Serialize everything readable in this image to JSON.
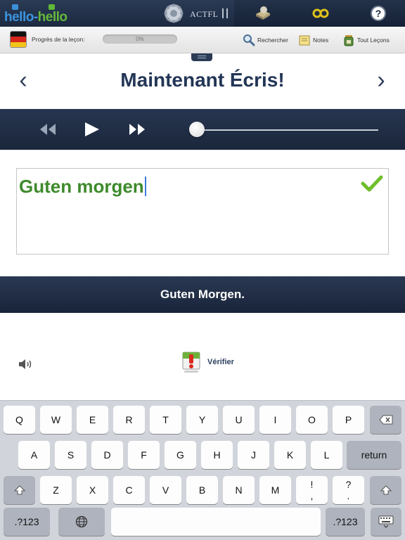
{
  "app": {
    "logo": {
      "part1": "hello-",
      "part2": "hello"
    },
    "badge": "ACTFL",
    "top_icons": [
      "lessons-book-icon",
      "glasses-icon",
      "help-icon"
    ],
    "colors": {
      "navy": "#233656",
      "green": "#3e8a2c",
      "blue": "#3b8fd8"
    }
  },
  "toolbar": {
    "progress_label": "Progrès de la leçon:",
    "progress_value": "0%",
    "progress_fraction": 0,
    "search_label": "Rechercher",
    "notes_label": "Notes",
    "lessons_label": "Tout Leçons"
  },
  "header": {
    "title": "Maintenant Écris!",
    "prev": "‹",
    "next": "›"
  },
  "player": {
    "position_fraction": 0
  },
  "answer": {
    "value": "Guten morgen",
    "correct": "Guten Morgen."
  },
  "actions": {
    "verify_label": "Vérifier"
  },
  "keyboard": {
    "row1": [
      "Q",
      "W",
      "E",
      "R",
      "T",
      "Y",
      "U",
      "I",
      "O",
      "P"
    ],
    "row2": [
      "A",
      "S",
      "D",
      "F",
      "G",
      "H",
      "J",
      "K",
      "L"
    ],
    "row3": [
      "Z",
      "X",
      "C",
      "V",
      "B",
      "N",
      "M"
    ],
    "punct1": [
      "!",
      ","
    ],
    "punct2": [
      "?",
      "."
    ],
    "return_label": "return",
    "numbers_label": ".?123"
  }
}
